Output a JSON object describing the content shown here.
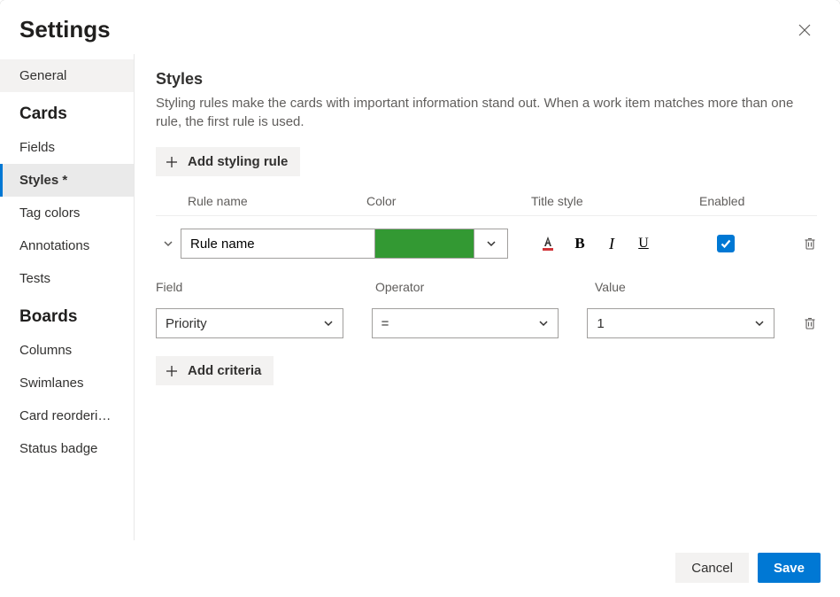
{
  "dialog": {
    "title": "Settings"
  },
  "sidebar": {
    "general": "General",
    "groups": [
      {
        "title": "Cards",
        "items": [
          "Fields",
          "Styles *",
          "Tag colors",
          "Annotations",
          "Tests"
        ],
        "active": 1
      },
      {
        "title": "Boards",
        "items": [
          "Columns",
          "Swimlanes",
          "Card reorderi…",
          "Status badge"
        ]
      }
    ]
  },
  "content": {
    "title": "Styles",
    "description": "Styling rules make the cards with important information stand out. When a work item matches more than one rule, the first rule is used.",
    "addStylingRule": "Add styling rule",
    "columns": {
      "name": "Rule name",
      "color": "Color",
      "titleStyle": "Title style",
      "enabled": "Enabled"
    },
    "rule": {
      "nameValue": "Rule name",
      "colorHex": "#339933",
      "enabled": true
    },
    "criteriaHeaders": {
      "field": "Field",
      "operator": "Operator",
      "value": "Value"
    },
    "criteria": {
      "field": "Priority",
      "operator": "=",
      "value": "1"
    },
    "addCriteria": "Add criteria"
  },
  "footer": {
    "cancel": "Cancel",
    "save": "Save"
  }
}
